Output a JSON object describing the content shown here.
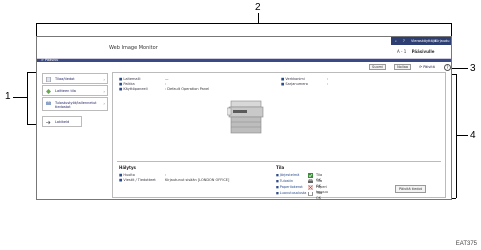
{
  "callouts": [
    "1",
    "2",
    "3",
    "4"
  ],
  "header": {
    "app_title": "Web Image Monitor",
    "user_label": "Vieraskäyttäjä",
    "login_label": "Kirjaudu",
    "page_icons_text": "A  -  1",
    "home_link": "Pääsivulle",
    "breadcrumb": "> Pääsivu"
  },
  "sidebar": {
    "items": [
      {
        "label": "Tilaa/tiedot"
      },
      {
        "label": "Laitteen tila"
      },
      {
        "label": "Tulostustyöt/tallennetut tiedostot"
      }
    ],
    "logout_label": "Lokikeld"
  },
  "toolbar": {
    "select_value": "Suomi",
    "refresh_label": "Nollaa",
    "help_link": "Päivitä",
    "help_icon": "?"
  },
  "device_info": [
    {
      "key": "Laitemalli",
      "value": "—"
    },
    {
      "key": "Paikka",
      "value": ":"
    },
    {
      "key": "Käyttöpaneeli",
      "value": ": Default Operation Panel"
    }
  ],
  "device_info_right": [
    {
      "key": "Verkkonimi",
      "value": ":"
    },
    {
      "key": "Sarjanumero",
      "value": ":"
    }
  ],
  "alerts": {
    "title": "Hälytys",
    "rows": [
      {
        "key": "Huolto",
        "value": ":"
      },
      {
        "key": "Viestit / Tiedotteet",
        "value": "Kirjautunut sisään [LONDON OFFICE]"
      }
    ]
  },
  "status": {
    "title": "Tila",
    "rows": [
      {
        "label": "Järjestelmä",
        "value": "Tila OK",
        "icon": "status-ok-icon"
      },
      {
        "label": "Tulostin",
        "value": "Tila OK",
        "icon": "printer-ok-icon"
      },
      {
        "label": "Paperilokerot",
        "value": "Paperi loppuu",
        "icon": "paper-warning-icon"
      },
      {
        "label": "Luovutusalusta",
        "value": "Tila OK",
        "icon": "tray-ok-icon"
      }
    ],
    "refresh_button": "Päivitä tiedot"
  },
  "caption": "EAT375",
  "colors": {
    "accent": "#3a4a86",
    "dark_bar": "#2d3e72",
    "link": "#2a4a8a"
  }
}
